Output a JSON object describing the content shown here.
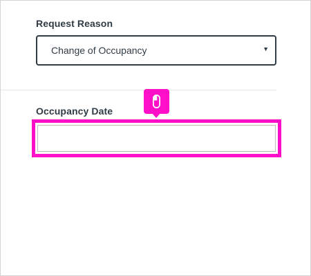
{
  "form": {
    "request_reason": {
      "label": "Request Reason",
      "selected_value": "Change of Occupancy",
      "caret_icon": "caret-down-icon"
    },
    "occupancy_date": {
      "label": "Occupancy Date",
      "value": "",
      "placeholder": ""
    }
  },
  "click_indicator": {
    "icon": "mouse-icon"
  },
  "colors": {
    "highlight": "#ff0fc8",
    "text": "#2f3b45",
    "border": "#2f3b45"
  }
}
